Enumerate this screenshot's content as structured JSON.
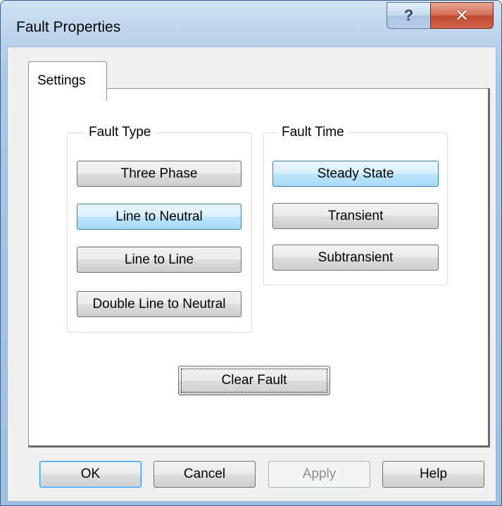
{
  "window": {
    "title": "Fault Properties"
  },
  "titlebar": {
    "help_glyph": "?",
    "close_glyph": "✕"
  },
  "tabs": [
    {
      "label": "Settings",
      "active": true
    }
  ],
  "fault_type": {
    "title": "Fault Type",
    "options": [
      {
        "label": "Three Phase",
        "selected": false
      },
      {
        "label": "Line to Neutral",
        "selected": true
      },
      {
        "label": "Line to Line",
        "selected": false
      },
      {
        "label": "Double Line to Neutral",
        "selected": false
      }
    ]
  },
  "fault_time": {
    "title": "Fault Time",
    "options": [
      {
        "label": "Steady State",
        "selected": true
      },
      {
        "label": "Transient",
        "selected": false
      },
      {
        "label": "Subtransient",
        "selected": false
      }
    ]
  },
  "clear_fault": {
    "label": "Clear Fault"
  },
  "footer": {
    "ok": "OK",
    "cancel": "Cancel",
    "apply": "Apply",
    "help": "Help"
  },
  "colors": {
    "selected_button": "#bee6fd",
    "close_button": "#c04a2f"
  }
}
